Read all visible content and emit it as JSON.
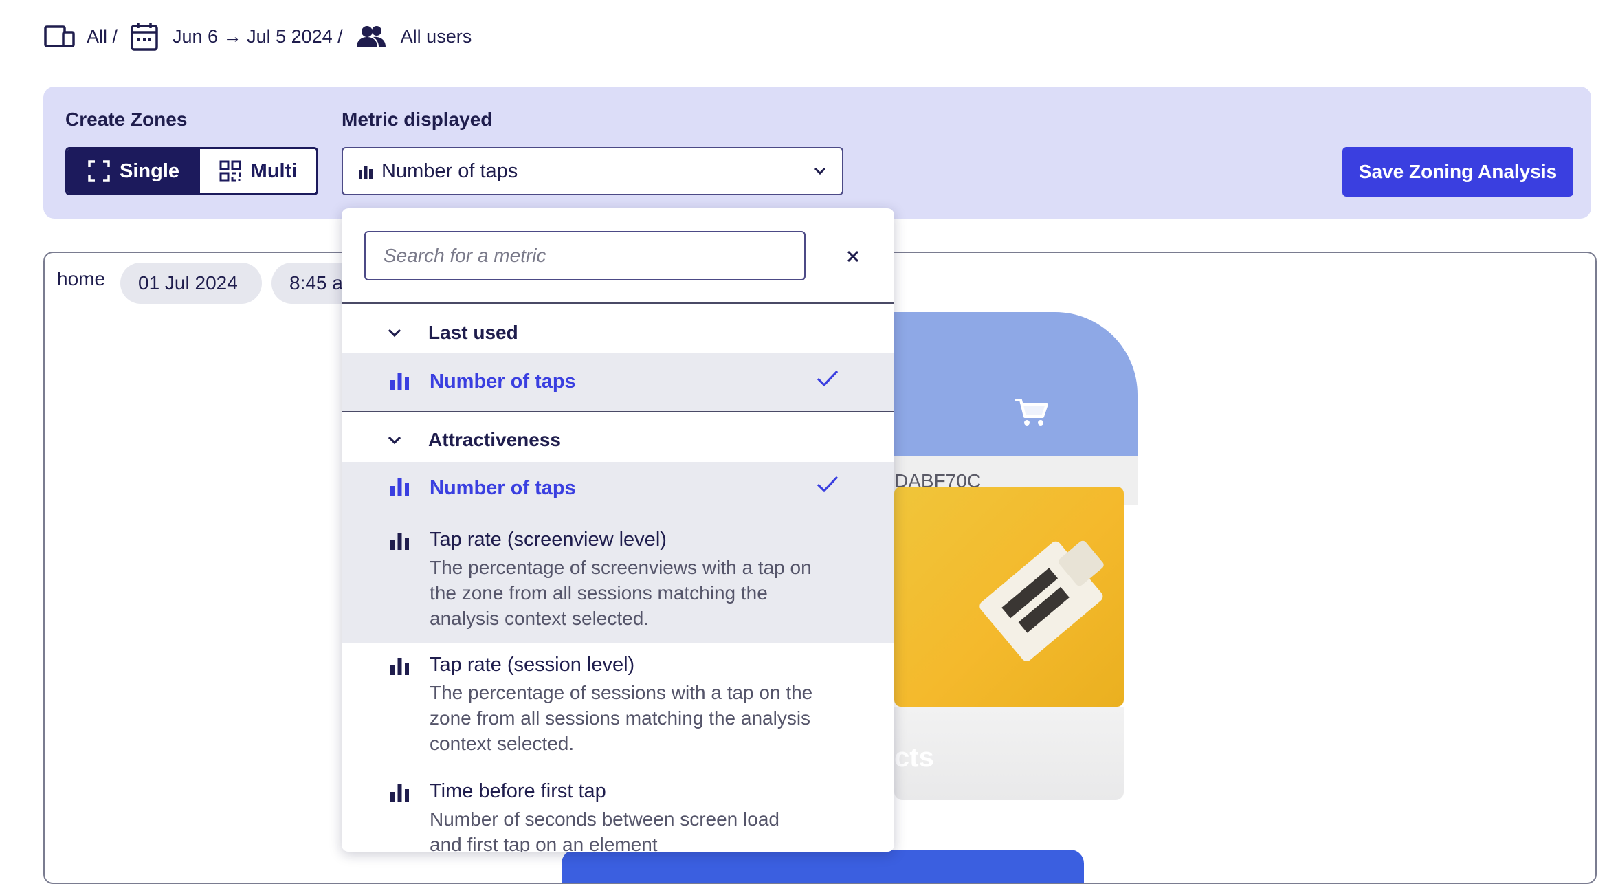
{
  "breadcrumb": {
    "platform": "All /",
    "date_range": "Jun 6 → Jul 5 2024 /",
    "segment": "All users"
  },
  "toolbar": {
    "create_zones_label": "Create Zones",
    "single_label": "Single",
    "multi_label": "Multi",
    "metric_label": "Metric displayed",
    "metric_value": "Number of taps",
    "save_label": "Save Zoning Analysis"
  },
  "canvas": {
    "screen_name": "home",
    "date": "01 Jul 2024",
    "time": "8:45 a",
    "screen_id": "DABF70C",
    "card_text": "cts"
  },
  "dropdown": {
    "search_placeholder": "Search for a metric",
    "groups": [
      {
        "label": "Last used",
        "items": [
          {
            "title": "Number of taps",
            "active": true
          }
        ]
      },
      {
        "label": "Attractiveness",
        "items": [
          {
            "title": "Number of taps",
            "active": true
          },
          {
            "title": "Tap rate (screenview level)",
            "description": "The percentage of screenviews with a tap on the zone from all sessions matching the analysis context selected."
          },
          {
            "title": "Tap rate (session level)",
            "description": "The percentage of sessions with a tap on the zone from all sessions matching the analysis context selected."
          },
          {
            "title": "Time before first tap",
            "description": "Number of seconds between screen load and first tap on an element"
          }
        ]
      }
    ]
  },
  "colors": {
    "accent": "#3a3fe0",
    "navy": "#1c1a5c",
    "panel": "#dcddf8",
    "selected_row": "#e9eaf0"
  },
  "icons": [
    "devices-icon",
    "calendar-icon",
    "users-icon",
    "select-zone-icon",
    "multi-zone-icon",
    "bar-chart-icon",
    "chevron-down-icon",
    "close-icon",
    "check-icon",
    "cart-icon"
  ]
}
